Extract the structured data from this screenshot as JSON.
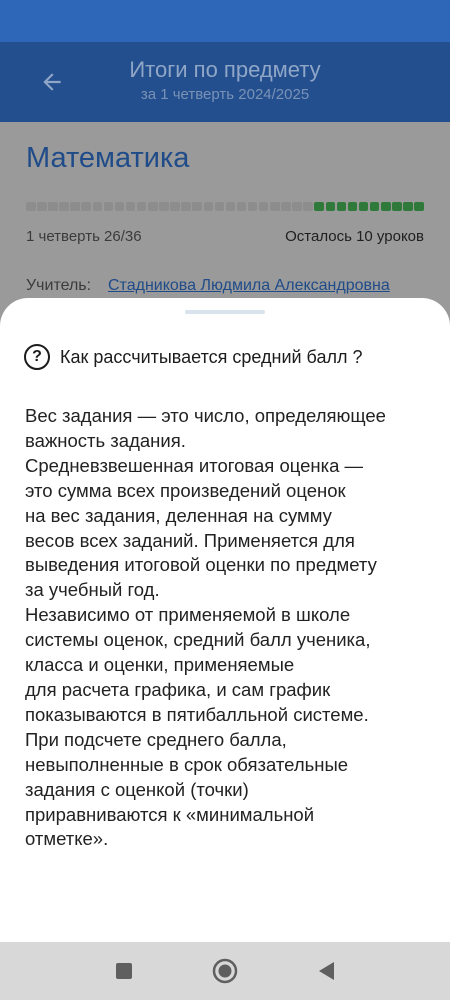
{
  "app_bar": {
    "title": "Итоги по предмету",
    "subtitle": "за 1 четверть 2024/2025",
    "back_icon": "arrow-left-icon"
  },
  "subject": {
    "name": "Математика",
    "progress": {
      "completed": 26,
      "total": 36,
      "done_color": "#2f7a3a",
      "pending_color": "#8d8d8d"
    },
    "period_label": "1 четверть  26/36",
    "remaining_label": "Осталось 10 уроков",
    "teacher_label": "Учитель:",
    "teacher_name": "Стадникова Людмила Александровна"
  },
  "sheet": {
    "icon": "help-circle-icon",
    "icon_glyph": "?",
    "title": "Как рассчитывается средний балл ?",
    "lines": [
      "Вес задания — это число, определяющее",
      "важность задания.",
      "Средневзвешенная итоговая оценка —",
      "это сумма всех произведений оценок",
      "на вес задания, деленная на сумму",
      "весов всех заданий. Применяется для",
      "выведения итоговой оценки по предмету",
      "за учебный год.",
      "Независимо от применяемой в школе",
      "системы оценок, средний балл ученика,",
      "класса и оценки, применяемые",
      "для расчета графика, и сам график",
      "показываются в пятибалльной системе.",
      "При подсчете среднего балла,",
      "невыполненные в срок обязательные",
      "задания с оценкой (точки)",
      "приравниваются к «минимальной",
      "отметке»."
    ]
  },
  "nav": {
    "recents": "square-icon",
    "home": "circle-home-icon",
    "back": "triangle-back-icon"
  },
  "colors": {
    "status_bar": "#2f67b8",
    "app_bar": "#234f8f",
    "accent": "#1f4b88"
  }
}
